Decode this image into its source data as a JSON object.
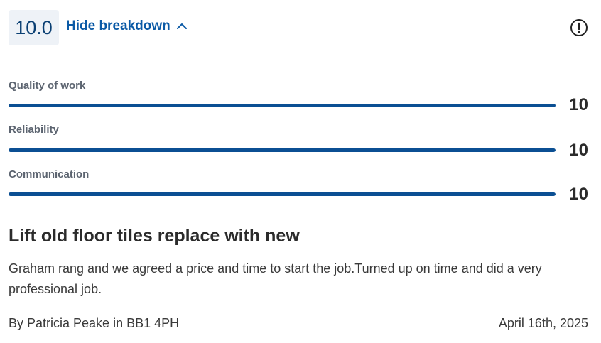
{
  "header": {
    "score": "10.0",
    "toggle_label": "Hide breakdown",
    "toggle_icon": "chevron-up-icon",
    "report_icon": "exclamation-circle-icon"
  },
  "ratings": [
    {
      "label": "Quality of work",
      "value": "10",
      "fill_fraction": 1.0
    },
    {
      "label": "Reliability",
      "value": "10",
      "fill_fraction": 1.0
    },
    {
      "label": "Communication",
      "value": "10",
      "fill_fraction": 1.0
    }
  ],
  "review": {
    "title": "Lift old floor tiles replace with new",
    "body": "Graham rang and we agreed a price and time to start the job.Turned up on time and did a very professional job.",
    "author_line": "By Patricia Peake in BB1 4PH",
    "date": "April 16th, 2025"
  },
  "colors": {
    "accent": "#0b5aa6",
    "bar": "#0b4f93",
    "score_bg": "#eef2f7"
  }
}
